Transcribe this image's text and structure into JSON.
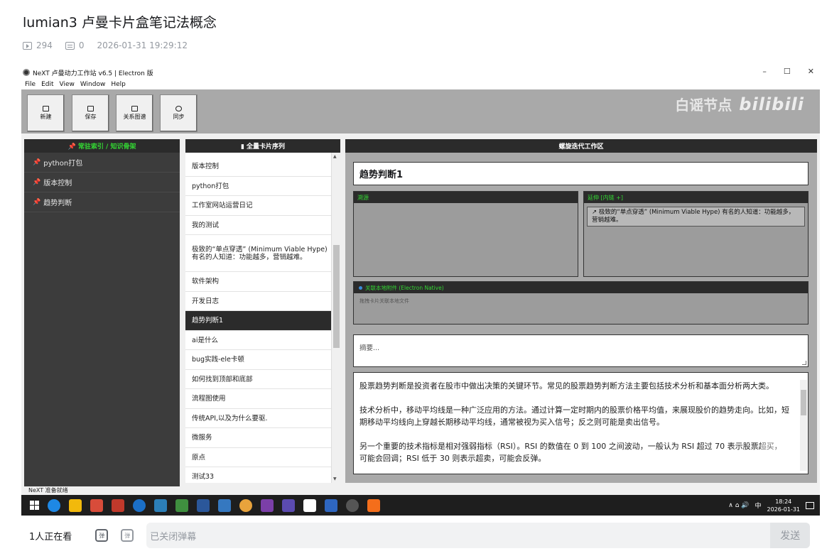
{
  "video": {
    "title": "lumian3 卢曼卡片盒笔记法概念",
    "views": "294",
    "danmaku": "0",
    "datetime": "2026-01-31 19:29:12"
  },
  "app": {
    "window_title": "NeXT 卢曼动力工作站 v6.5 | Electron 版",
    "window_controls": [
      "–",
      "☐",
      "✕"
    ],
    "menu": [
      "File",
      "Edit",
      "View",
      "Window",
      "Help"
    ],
    "toolbar": [
      "新建",
      "保存",
      "关系图谱",
      "同步"
    ],
    "watermark_text": "白谣节点",
    "watermark_logo": "bilibili",
    "status": "NeXT 准备就绪"
  },
  "sidebar": {
    "header": "📌 常驻索引 / 知识骨架",
    "items": [
      "python打包",
      "版本控制",
      "趋势判断"
    ]
  },
  "cardlist": {
    "header": "▮ 全量卡片序列",
    "items": [
      "版本控制",
      "python打包",
      "工作室网站运营日记",
      "我的测试",
      "极致的“单点穿透” (Minimum Viable Hype) 有名的人知道：功能越多，营销越难。",
      "软件架构",
      "开发日志",
      "趋势判断1",
      "ai是什么",
      "bug实践-ele卡顿",
      "如何找到顶部和底部",
      "流程图使用",
      "传统API,以及为什么要驱.",
      "微服务",
      "原点",
      "测试33"
    ],
    "active_index": 7
  },
  "workspace": {
    "header": "螺旋迭代工作区",
    "title": "趋势判断1",
    "left_box_head": "溯源",
    "right_box_head": "延伸 [内链 +]",
    "link_chip": "↗ 极致的“单点穿透” (Minimum Viable Hype) 有名的人知道：功能越多，营销越难。",
    "attach_head": "关联本地附件 (Electron Native)",
    "attach_hint": "拖拽卡片关联本地文件",
    "summary_placeholder": "摘要...",
    "body": [
      "股票趋势判断是投资者在股市中做出决策的关键环节。常见的股票趋势判断方法主要包括技术分析和基本面分析两大类。",
      "技术分析中，移动平均线是一种广泛应用的方法。通过计算一定时期内的股票价格平均值，来展现股价的趋势走向。比如，短期移动平均线向上穿越长期移动平均线，通常被视为买入信号；反之则可能是卖出信号。",
      "另一个重要的技术指标是相对强弱指标（RSI）。RSI 的数值在 0 到 100 之间波动，一般认为 RSI 超过 70 表示股票超买，可能会回调；RSI 低于 30 则表示超卖，可能会反弹。"
    ]
  },
  "float_ctrl": "可能",
  "taskbar": {
    "ime": "中",
    "time": "18:24",
    "date": "2026-01-31",
    "tray_icons": "∧ ⌂ 🔊"
  },
  "bottom": {
    "viewers": "1人正在看",
    "danmu_on_icon": "弹",
    "danmu_off_icon": "弹",
    "placeholder": "已关闭弹幕",
    "send": "发送"
  }
}
